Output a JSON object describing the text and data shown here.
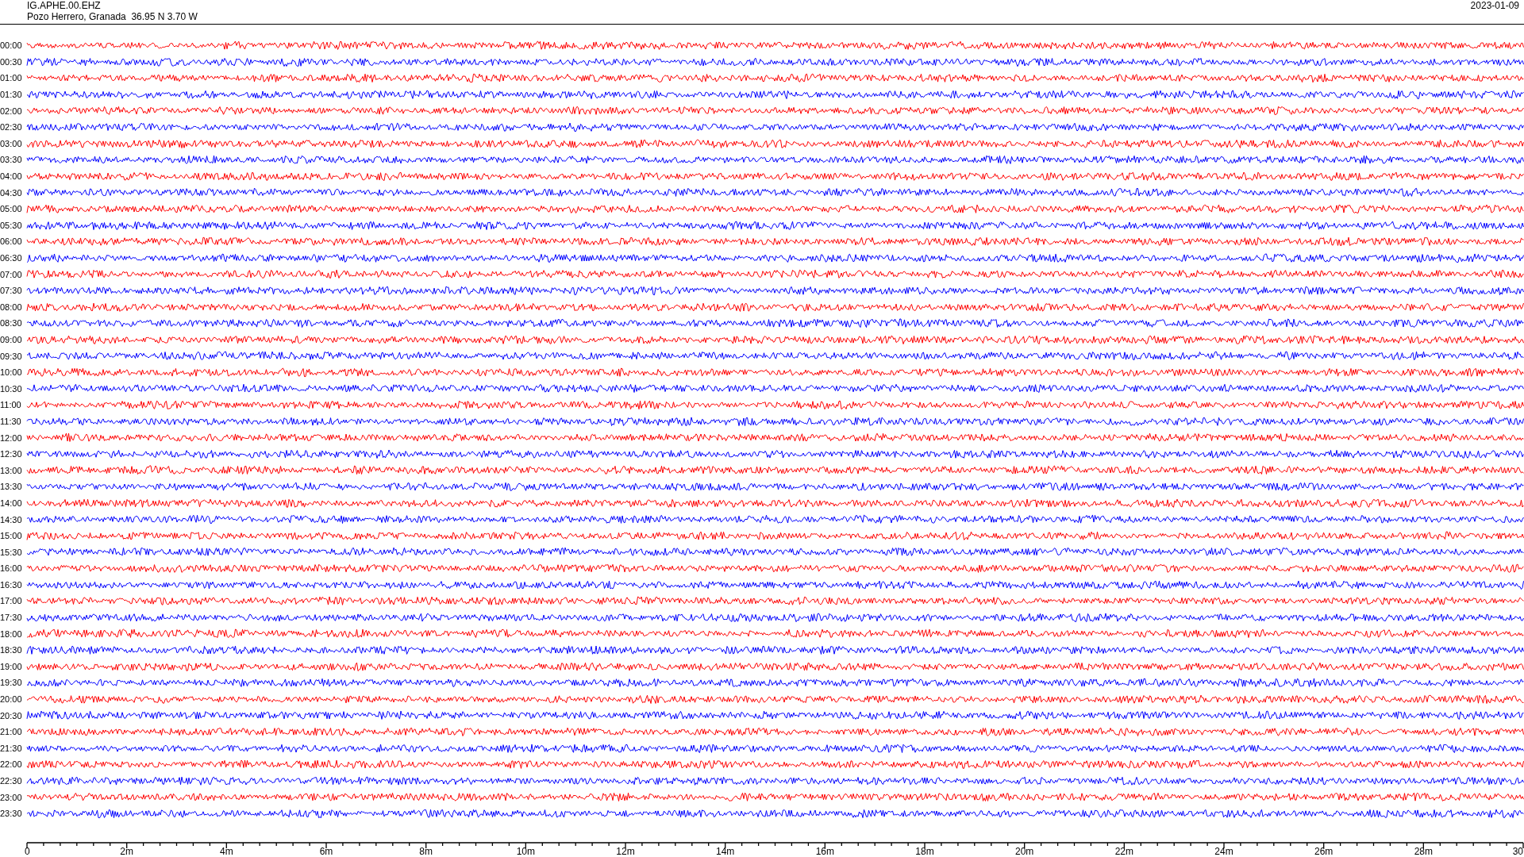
{
  "header": {
    "station": "IG.APHE.00.EHZ",
    "location": "Pozo Herrero, Granada  36.95 N 3.70 W",
    "date": "2023-01-09"
  },
  "traces": [
    {
      "time": "00:00",
      "color": "#ff0000"
    },
    {
      "time": "00:30",
      "color": "#0000ff"
    },
    {
      "time": "01:00",
      "color": "#ff0000"
    },
    {
      "time": "01:30",
      "color": "#0000ff"
    },
    {
      "time": "02:00",
      "color": "#ff0000"
    },
    {
      "time": "02:30",
      "color": "#0000ff"
    },
    {
      "time": "03:00",
      "color": "#ff0000"
    },
    {
      "time": "03:30",
      "color": "#0000ff"
    },
    {
      "time": "04:00",
      "color": "#ff0000"
    },
    {
      "time": "04:30",
      "color": "#0000ff"
    },
    {
      "time": "05:00",
      "color": "#ff0000"
    },
    {
      "time": "05:30",
      "color": "#0000ff"
    },
    {
      "time": "06:00",
      "color": "#ff0000"
    },
    {
      "time": "06:30",
      "color": "#0000ff"
    },
    {
      "time": "07:00",
      "color": "#ff0000"
    },
    {
      "time": "07:30",
      "color": "#0000ff"
    },
    {
      "time": "08:00",
      "color": "#ff0000"
    },
    {
      "time": "08:30",
      "color": "#0000ff"
    },
    {
      "time": "09:00",
      "color": "#ff0000"
    },
    {
      "time": "09:30",
      "color": "#0000ff"
    },
    {
      "time": "10:00",
      "color": "#ff0000"
    },
    {
      "time": "10:30",
      "color": "#0000ff"
    },
    {
      "time": "11:00",
      "color": "#ff0000"
    },
    {
      "time": "11:30",
      "color": "#0000ff"
    },
    {
      "time": "12:00",
      "color": "#ff0000"
    },
    {
      "time": "12:30",
      "color": "#0000ff"
    },
    {
      "time": "13:00",
      "color": "#ff0000"
    },
    {
      "time": "13:30",
      "color": "#0000ff"
    },
    {
      "time": "14:00",
      "color": "#ff0000"
    },
    {
      "time": "14:30",
      "color": "#0000ff"
    },
    {
      "time": "15:00",
      "color": "#ff0000"
    },
    {
      "time": "15:30",
      "color": "#0000ff"
    },
    {
      "time": "16:00",
      "color": "#ff0000"
    },
    {
      "time": "16:30",
      "color": "#0000ff"
    },
    {
      "time": "17:00",
      "color": "#ff0000"
    },
    {
      "time": "17:30",
      "color": "#0000ff"
    },
    {
      "time": "18:00",
      "color": "#ff0000"
    },
    {
      "time": "18:30",
      "color": "#0000ff"
    },
    {
      "time": "19:00",
      "color": "#ff0000"
    },
    {
      "time": "19:30",
      "color": "#0000ff"
    },
    {
      "time": "20:00",
      "color": "#ff0000"
    },
    {
      "time": "20:30",
      "color": "#0000ff"
    },
    {
      "time": "21:00",
      "color": "#ff0000"
    },
    {
      "time": "21:30",
      "color": "#0000ff"
    },
    {
      "time": "22:00",
      "color": "#ff0000"
    },
    {
      "time": "22:30",
      "color": "#0000ff"
    },
    {
      "time": "23:00",
      "color": "#ff0000"
    },
    {
      "time": "23:30",
      "color": "#0000ff"
    }
  ],
  "x_axis": {
    "ticks": [
      "0",
      "2m",
      "4m",
      "6m",
      "8m",
      "10m",
      "12m",
      "14m",
      "16m",
      "18m",
      "20m",
      "22m",
      "24m",
      "26m",
      "28m",
      "30"
    ]
  }
}
